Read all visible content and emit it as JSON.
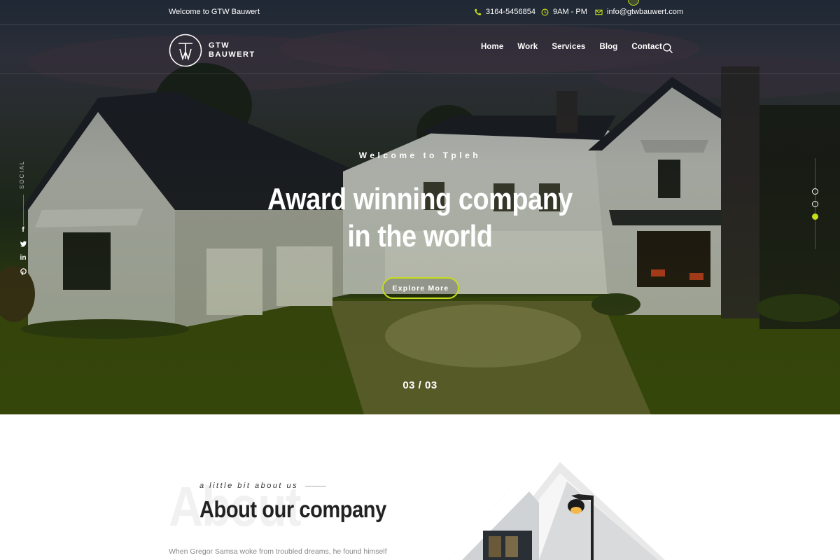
{
  "topbar": {
    "welcome": "Welcome to GTW Bauwert",
    "phone": "3164-5456854",
    "hours": "9AM - PM",
    "email": "info@gtwbauwert.com",
    "icons": [
      "phone-icon",
      "clock-icon",
      "mail-icon"
    ]
  },
  "brand": {
    "line1": "GTW",
    "line2": "BAUWERT"
  },
  "nav": {
    "items": [
      "Home",
      "Work",
      "Services",
      "Blog",
      "Contact"
    ]
  },
  "social": {
    "label": "SOCIAL",
    "icons": [
      "facebook-icon",
      "twitter-icon",
      "linkedin-icon",
      "pinterest-icon"
    ]
  },
  "hero": {
    "eyebrow": "Welcome to Tpleh",
    "headline_line1": "Award winning company",
    "headline_line2": "in the world",
    "cta": "Explore More",
    "counter": "03 / 03",
    "active_slide": 3,
    "total_slides": 3
  },
  "about": {
    "ghost": "About",
    "eyebrow": "a little bit about us",
    "title": "About our company",
    "body": "When Gregor Samsa woke from troubled dreams, he found himself trformed"
  },
  "colors": {
    "accent": "#c6dc1e",
    "hero_dark": "#1f2a1c",
    "text_dark": "#222222"
  }
}
